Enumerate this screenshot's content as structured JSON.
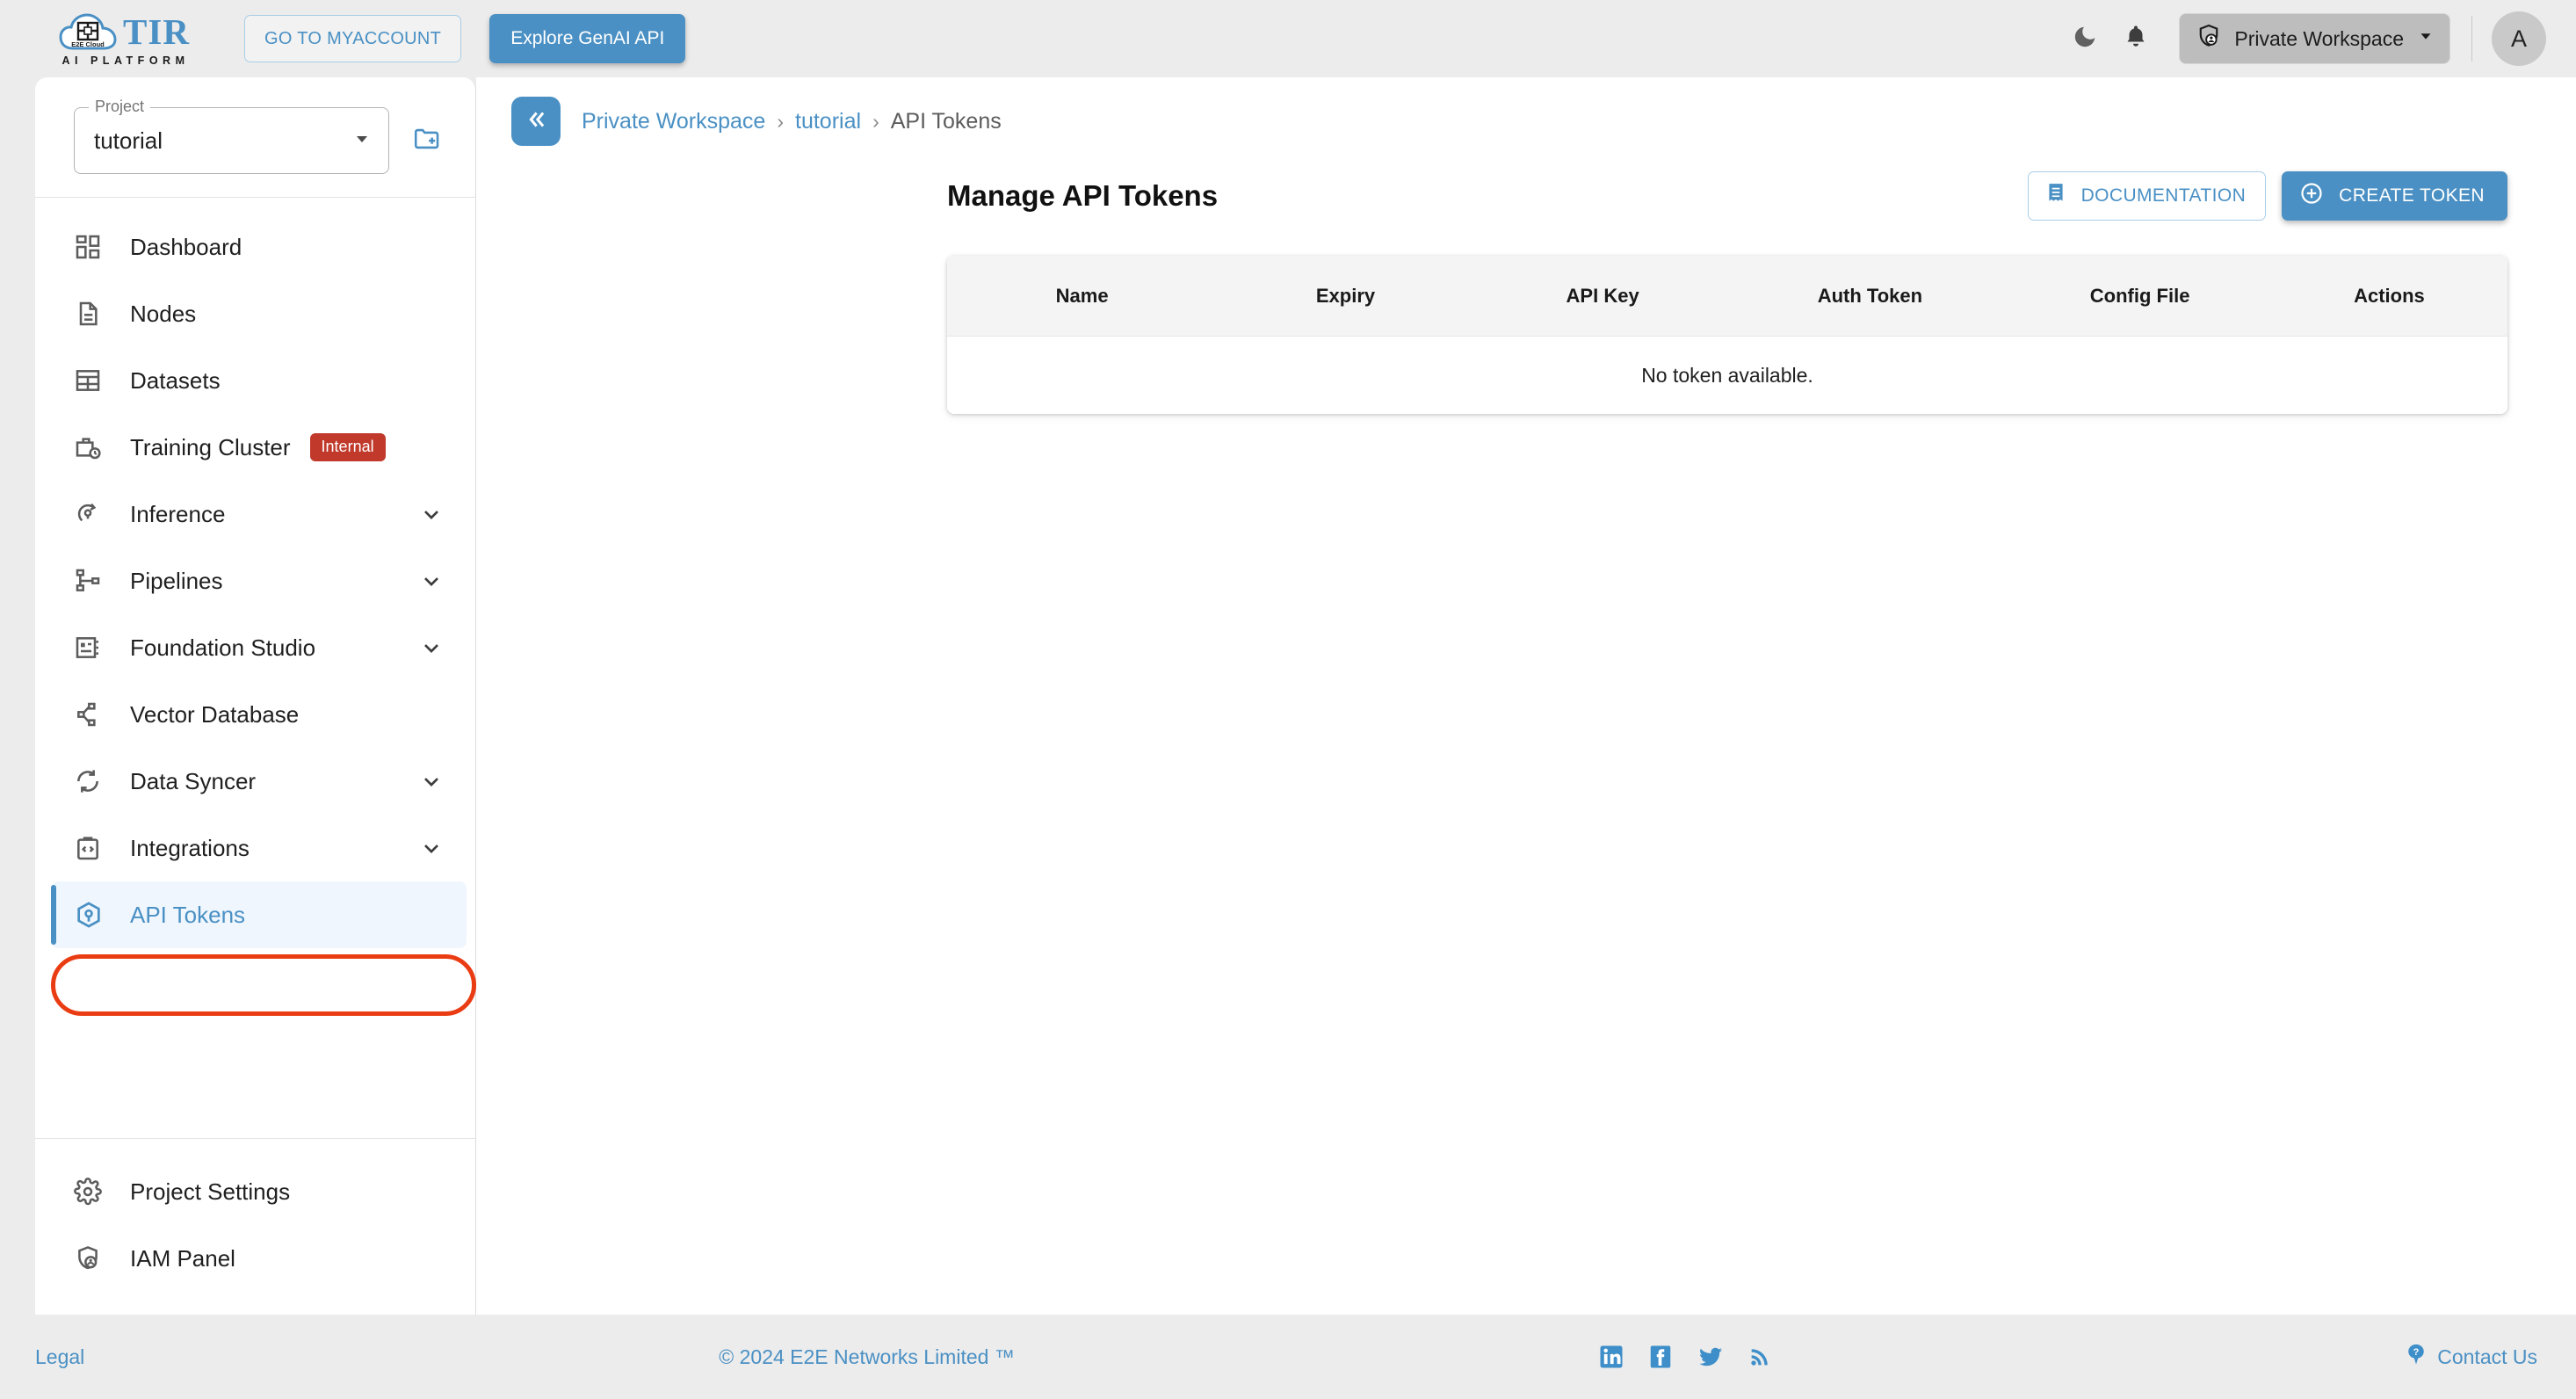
{
  "brand": {
    "logo_main": "TIR",
    "logo_sub": "AI PLATFORM",
    "logo_cloud_text": "E2E Cloud"
  },
  "topbar": {
    "myaccount_label": "GO TO MYACCOUNT",
    "genai_label": "Explore GenAI API",
    "dark_mode_icon": "moon-icon",
    "notifications_icon": "bell-icon",
    "workspace_label": "Private Workspace",
    "workspace_icon": "shield-user-icon",
    "avatar_initial": "A"
  },
  "sidebar": {
    "project_legend": "Project",
    "project_value": "tutorial",
    "new_project_icon": "new-folder-icon",
    "items": [
      {
        "label": "Dashboard",
        "icon": "dashboard-grid-icon",
        "caret": false,
        "badge": null,
        "active": false
      },
      {
        "label": "Nodes",
        "icon": "document-icon",
        "caret": false,
        "badge": null,
        "active": false
      },
      {
        "label": "Datasets",
        "icon": "table-grid-icon",
        "caret": false,
        "badge": null,
        "active": false
      },
      {
        "label": "Training Cluster",
        "icon": "briefcase-clock-icon",
        "caret": false,
        "badge": "Internal",
        "active": false
      },
      {
        "label": "Inference",
        "icon": "inference-icon",
        "caret": true,
        "badge": null,
        "active": false
      },
      {
        "label": "Pipelines",
        "icon": "pipeline-icon",
        "caret": true,
        "badge": null,
        "active": false
      },
      {
        "label": "Foundation Studio",
        "icon": "studio-icon",
        "caret": true,
        "badge": null,
        "active": false
      },
      {
        "label": "Vector Database",
        "icon": "share-nodes-icon",
        "caret": false,
        "badge": null,
        "active": false
      },
      {
        "label": "Data Syncer",
        "icon": "sync-icon",
        "caret": true,
        "badge": null,
        "active": false
      },
      {
        "label": "Integrations",
        "icon": "code-clipboard-icon",
        "caret": true,
        "badge": null,
        "active": false
      },
      {
        "label": "API Tokens",
        "icon": "cube-icon",
        "caret": false,
        "badge": null,
        "active": true
      }
    ],
    "bottom_items": [
      {
        "label": "Project Settings",
        "icon": "gear-icon"
      },
      {
        "label": "IAM Panel",
        "icon": "shield-user-icon"
      }
    ]
  },
  "main": {
    "collapse_icon": "chevron-double-left-icon",
    "breadcrumb": {
      "workspace": "Private Workspace",
      "project": "tutorial",
      "current": "API Tokens",
      "separator": "›"
    },
    "page_title": "Manage API Tokens",
    "documentation_label": "DOCUMENTATION",
    "documentation_icon": "receipt-icon",
    "create_label": "CREATE TOKEN",
    "create_icon": "plus-circle-icon",
    "table": {
      "columns": [
        "Name",
        "Expiry",
        "API Key",
        "Auth Token",
        "Config File",
        "Actions"
      ],
      "rows": [],
      "empty_message": "No token available."
    }
  },
  "footer": {
    "legal": "Legal",
    "copyright": "© 2024 E2E Networks Limited ™",
    "social": [
      "linkedin-icon",
      "facebook-icon",
      "twitter-icon",
      "rss-icon"
    ],
    "contact_label": "Contact Us",
    "contact_icon": "help-pin-icon"
  },
  "colors": {
    "accent": "#4a90c4",
    "active_bg": "#eff6fd",
    "badge_red": "#c0392b",
    "highlight_ring": "#ea3c13",
    "page_bg": "#ececec"
  }
}
